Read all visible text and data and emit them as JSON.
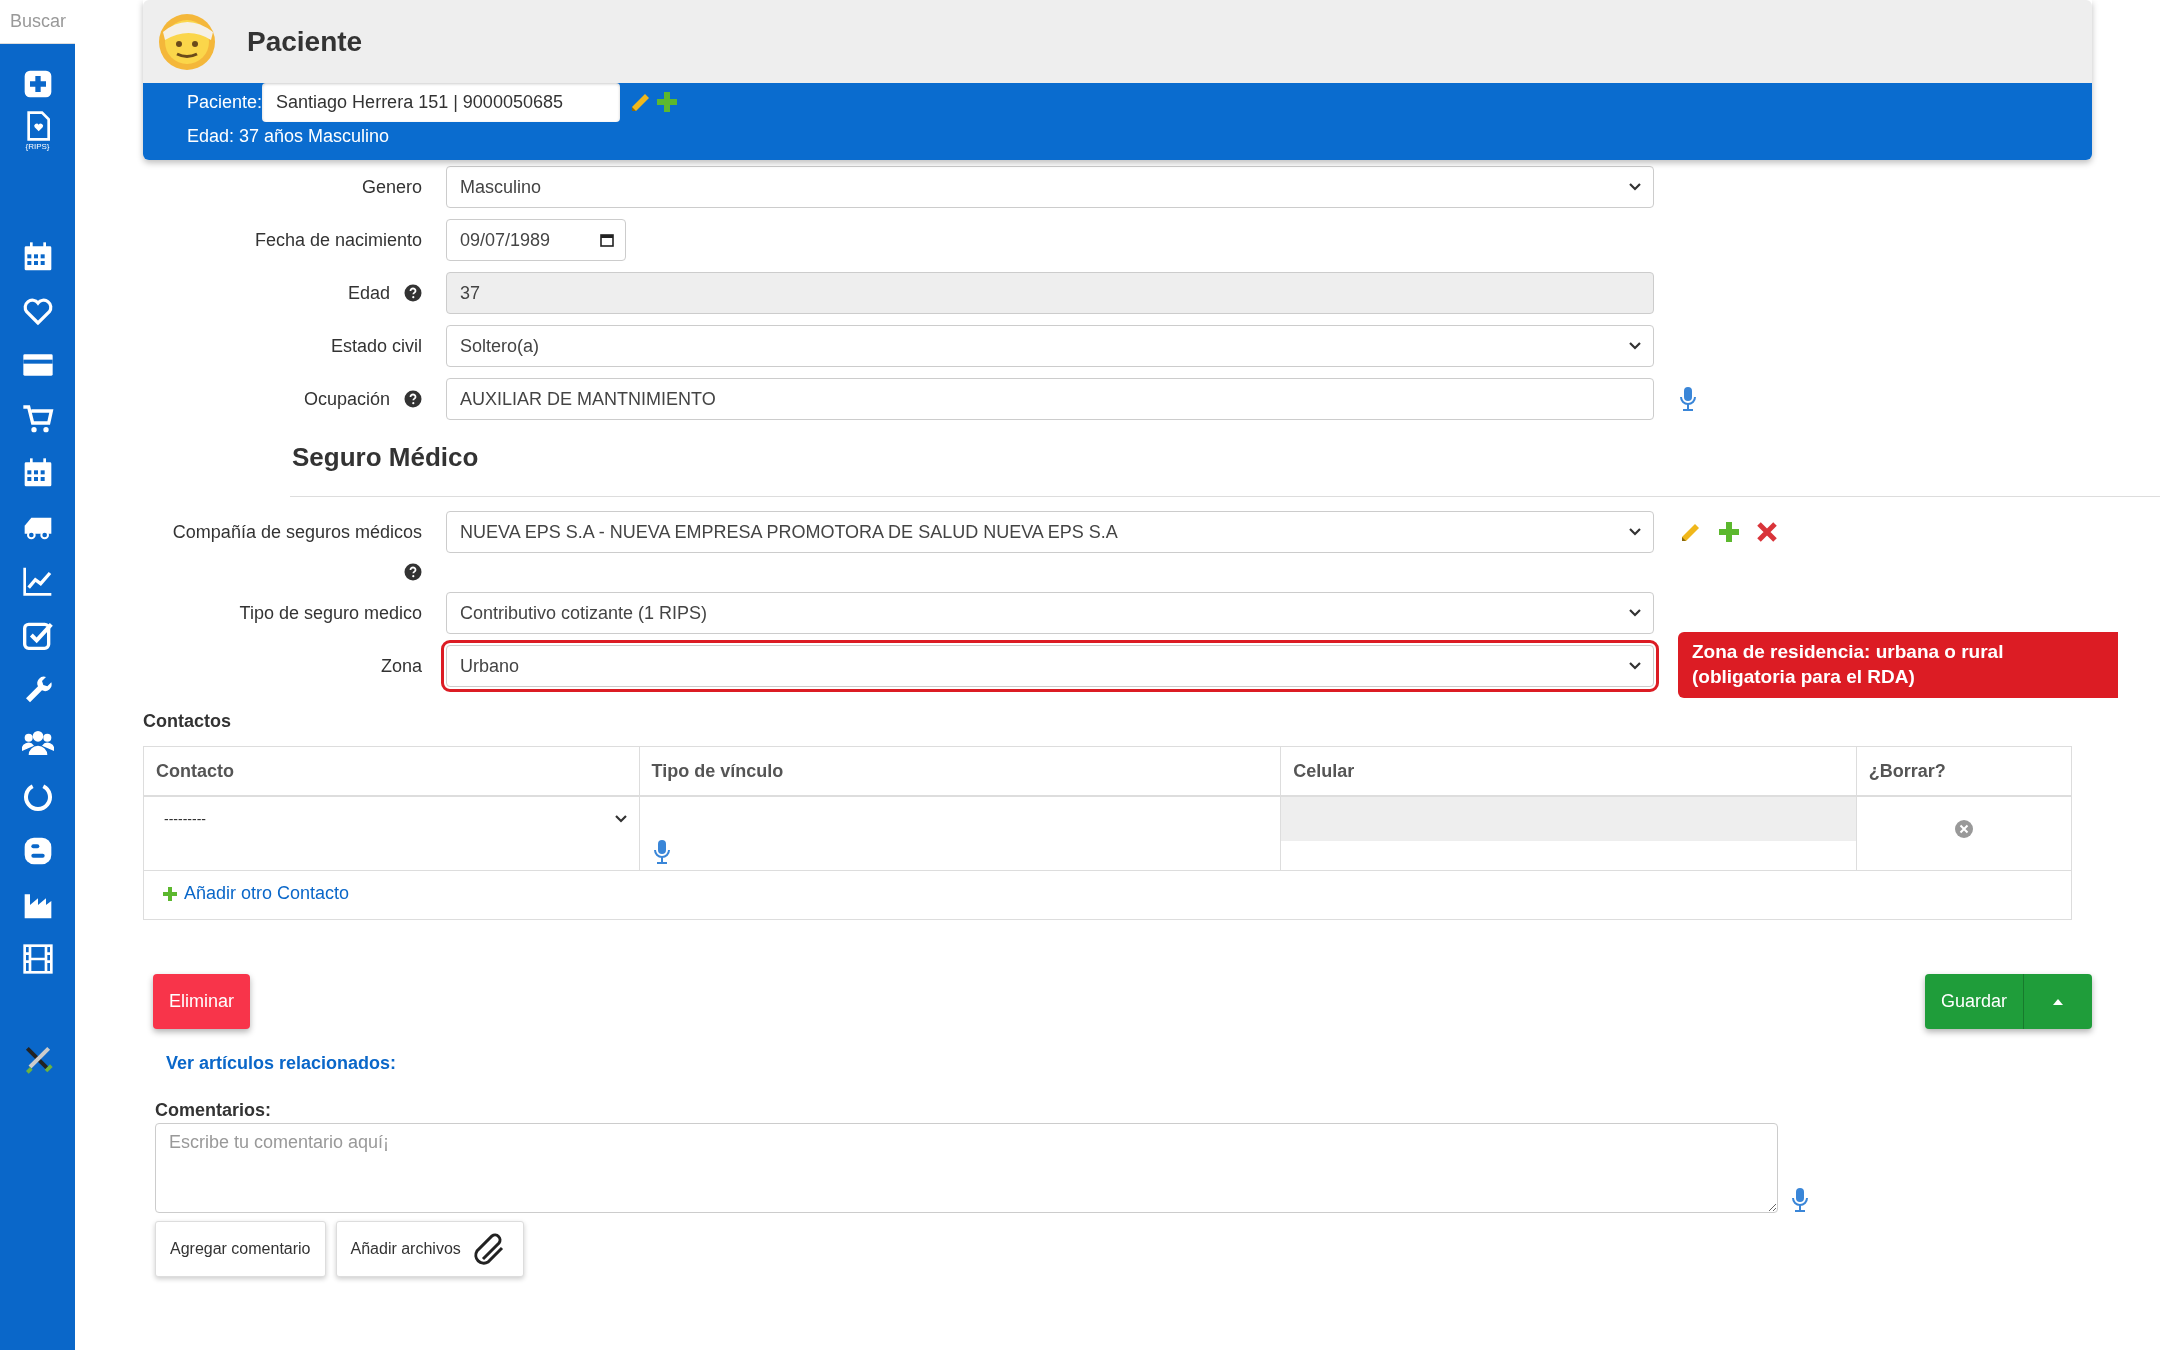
{
  "sidebar": {
    "search_placeholder": "Buscar",
    "rips_text": "{RIPS}"
  },
  "header": {
    "title": "Paciente",
    "patient_label": "Paciente:",
    "patient_value": "Santiago Herrera 151 | 9000050685",
    "summary": "Edad: 37 años Masculino"
  },
  "fields": [
    {
      "label": "Genero",
      "kind": "select",
      "value": "Masculino"
    },
    {
      "label": "Fecha de nacimiento",
      "kind": "date",
      "value": "09/07/1989"
    },
    {
      "label": "Edad",
      "kind": "readonly",
      "value": "37",
      "help": true
    },
    {
      "label": "Estado civil",
      "kind": "select",
      "value": "Soltero(a)"
    },
    {
      "label": "Ocupación",
      "kind": "text",
      "value": "AUXILIAR DE MANTNIMIENTO",
      "help": true,
      "mic": true
    }
  ],
  "insurance": {
    "title": "Seguro Médico",
    "fields": [
      {
        "label": "Compañía de seguros médicos",
        "kind": "select",
        "value": "NUEVA EPS S.A - NUEVA EMPRESA PROMOTORA DE SALUD NUEVA EPS S.A",
        "help": true,
        "help_below": true,
        "editable": true,
        "addable": true,
        "removable": true
      },
      {
        "label": "Tipo de seguro medico",
        "kind": "select",
        "value": "Contributivo cotizante (1 RIPS)"
      },
      {
        "label": "Zona",
        "kind": "select",
        "value": "Urbano",
        "invalid": true,
        "error": "Zona de residencia: urbana o rural (obligatoria para el RDA)"
      }
    ]
  },
  "contacts": {
    "title": "Contactos",
    "columns": [
      "Contacto",
      "Tipo de vínculo",
      "Celular",
      "¿Borrar?"
    ],
    "rows": [
      {
        "contact": "---------"
      }
    ],
    "add_link": "Añadir otro Contacto"
  },
  "actions": {
    "delete": "Eliminar",
    "save": "Guardar"
  },
  "related_link": "Ver artículos relacionados:",
  "comments": {
    "label": "Comentarios:",
    "placeholder": "Escribe tu comentario aquí¡",
    "buttons": [
      {
        "label": "Agregar comentario",
        "kind": "plain"
      },
      {
        "label": "Añadir archivos",
        "kind": "attach"
      }
    ]
  }
}
